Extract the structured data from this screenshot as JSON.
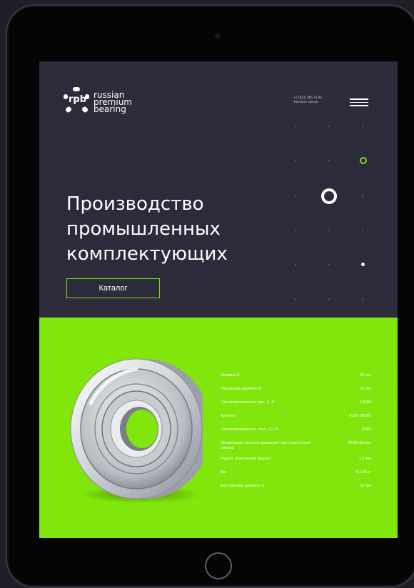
{
  "header": {
    "logo_mark": "rpb",
    "logo_lines": [
      "russian",
      "premium",
      "bearing"
    ],
    "contact_phone": "+7 (812) 485-73-46",
    "contact_link": "Заказать звонок"
  },
  "hero": {
    "title_lines": [
      "Производство",
      "промышленных",
      "комплектующих"
    ],
    "catalog_button": "Каталог"
  },
  "colors": {
    "hero_background": "#2b2b3b",
    "accent": "#80e60c",
    "frame": "#050506"
  },
  "product": {
    "image": "deep-groove-ball-bearing",
    "specs": [
      {
        "label": "Ширина B",
        "value": "15 мм"
      },
      {
        "label": "Наружный диаметр D",
        "value": "52 мм"
      },
      {
        "label": "Грузоподъемность дин. C, Н",
        "value": "14000"
      },
      {
        "label": "Артикул",
        "value": "6205-2RSTE"
      },
      {
        "label": "Грузоподъемность стат. C0, Н",
        "value": "6900"
      },
      {
        "label": "Предельная частота вращения при пластичной смазке",
        "value": "8500 об/мин"
      },
      {
        "label": "Радиус монтажной фаски r",
        "value": "1,5 мм"
      },
      {
        "label": "Вес",
        "value": "0,128 кг"
      },
      {
        "label": "Внутренний диаметр d",
        "value": "25 мм"
      }
    ]
  }
}
